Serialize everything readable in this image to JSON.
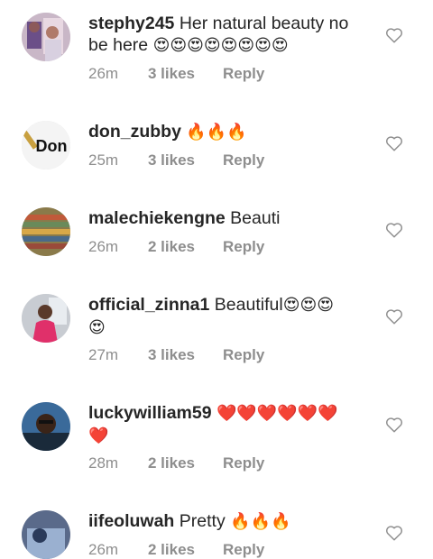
{
  "comments": [
    {
      "username": "stephy245",
      "text": "Her natural beauty no be here",
      "emoji": "😍😍😍😍😍😍😍😍",
      "time": "26m",
      "likes": "3 likes",
      "reply": "Reply",
      "heart_icon": "heart-outline-icon"
    },
    {
      "username": "don_zubby",
      "text": "",
      "emoji": "🔥🔥🔥",
      "time": "25m",
      "likes": "3 likes",
      "reply": "Reply",
      "avatar_logo_text": "Don",
      "heart_icon": "heart-outline-icon"
    },
    {
      "username": "malechiekengne",
      "text": "Beauti",
      "emoji": "",
      "time": "26m",
      "likes": "2 likes",
      "reply": "Reply",
      "heart_icon": "heart-outline-icon"
    },
    {
      "username": "official_zinna1",
      "text": "Beautiful",
      "emoji": "😍😍😍",
      "emoji2": "😍",
      "time": "27m",
      "likes": "3 likes",
      "reply": "Reply",
      "heart_icon": "heart-outline-icon"
    },
    {
      "username": "luckywilliam59",
      "text": "",
      "emoji": "❤️❤️❤️❤️❤️❤️",
      "emoji2": "❤️",
      "time": "28m",
      "likes": "2 likes",
      "reply": "Reply",
      "heart_icon": "heart-outline-icon"
    },
    {
      "username": "iifeoluwah",
      "text": "Pretty",
      "emoji": "🔥🔥🔥",
      "time": "26m",
      "likes": "2 likes",
      "reply": "Reply",
      "heart_icon": "heart-outline-icon"
    }
  ],
  "colors": {
    "text": "#262626",
    "meta": "#8e8e8e",
    "heart_red": "#e0191f"
  }
}
